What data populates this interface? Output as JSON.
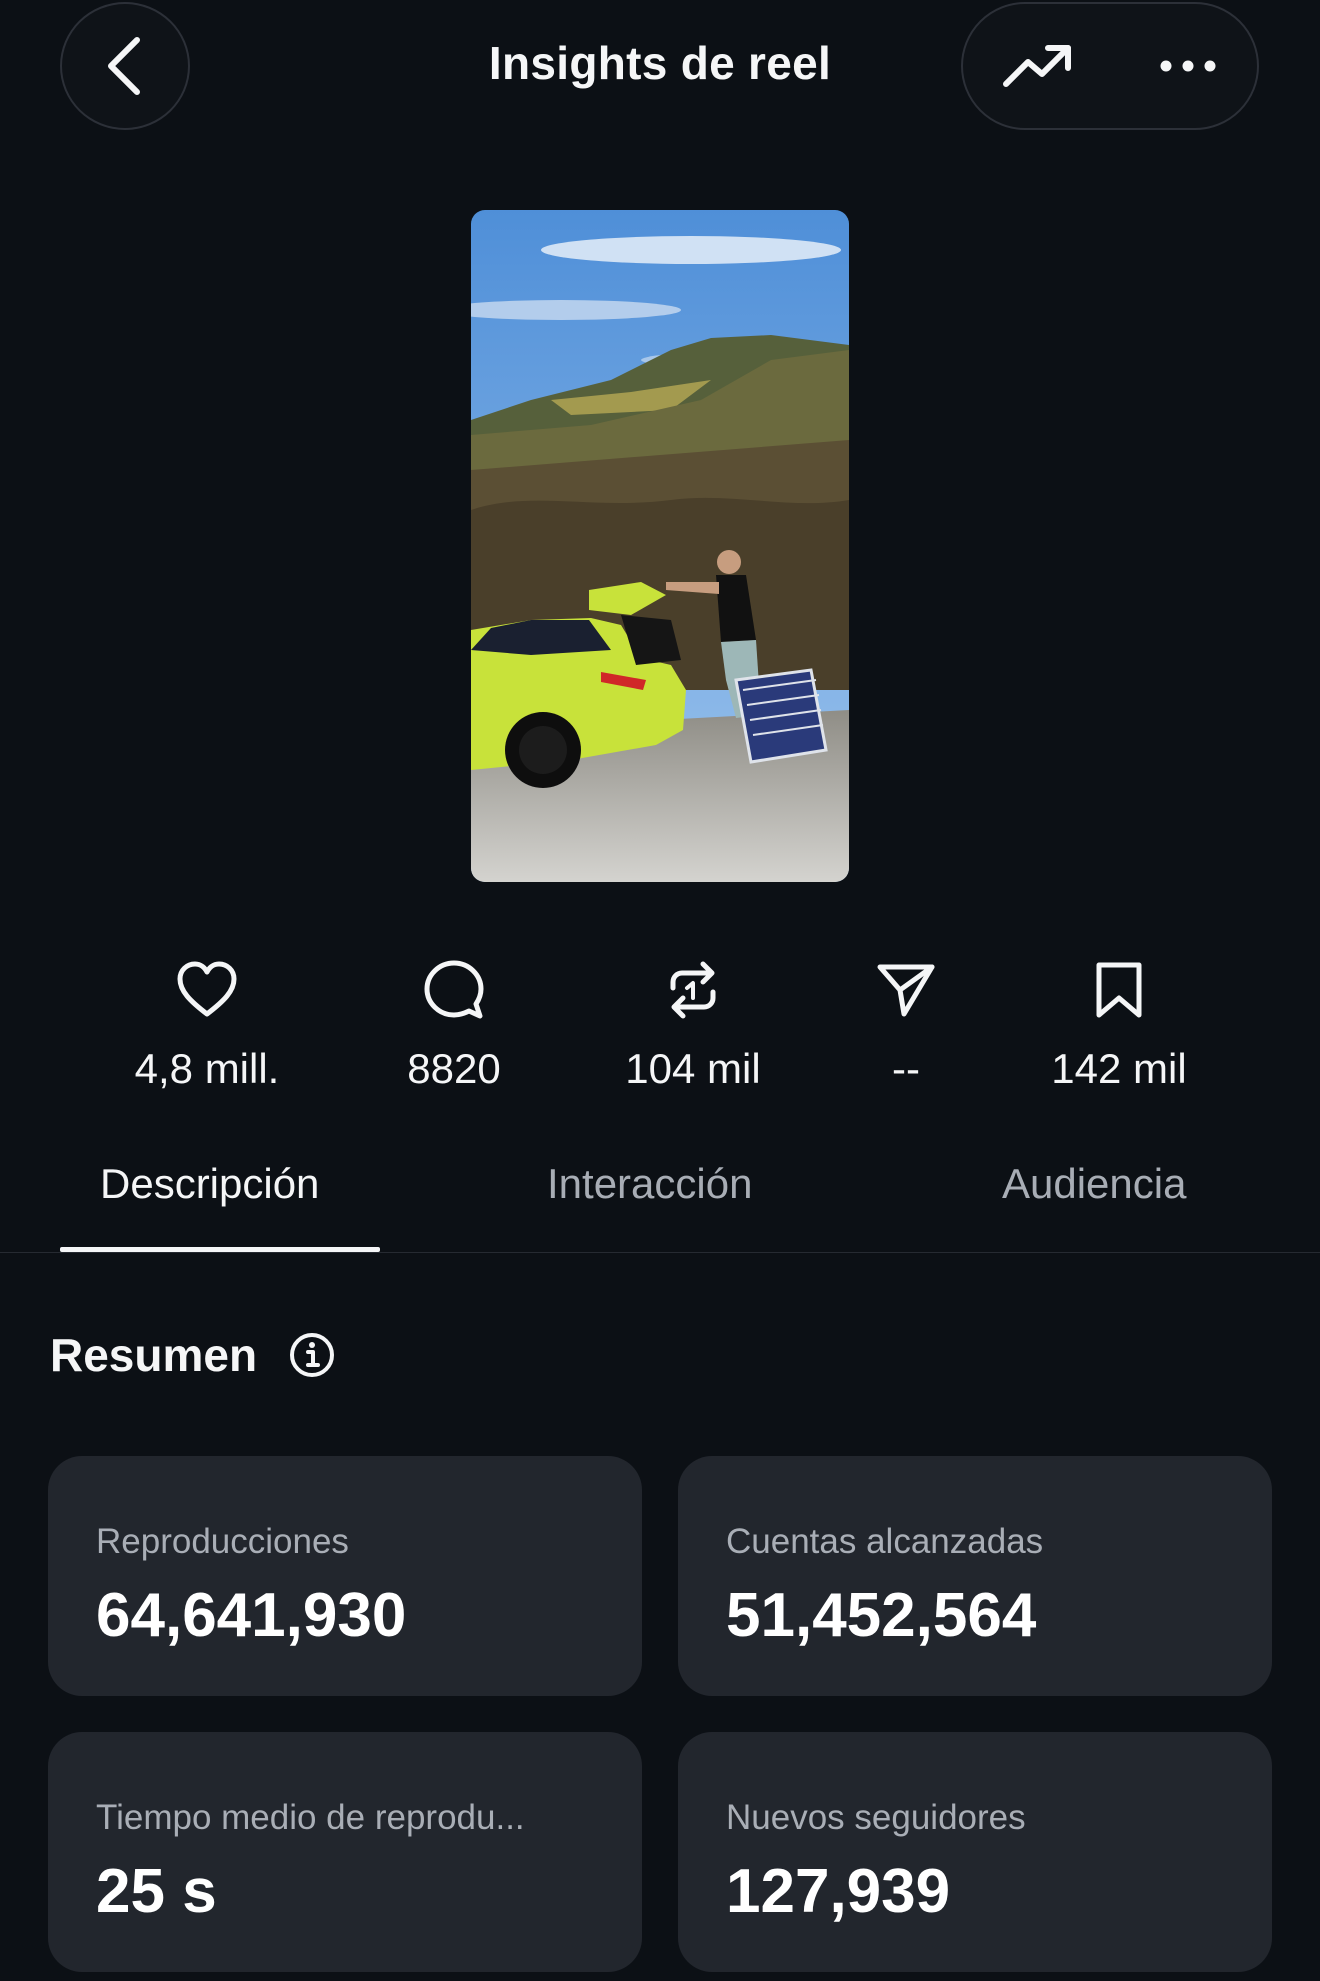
{
  "header": {
    "title": "Insights de reel"
  },
  "icons": {
    "back": "chevron-left-icon",
    "trend": "trend-up-icon",
    "more": "more-horizontal-icon"
  },
  "stats": [
    {
      "icon": "heart-icon",
      "value": "4,8 mill."
    },
    {
      "icon": "comment-icon",
      "value": "8820"
    },
    {
      "icon": "repost-icon",
      "value": "104 mil"
    },
    {
      "icon": "share-icon",
      "value": "--"
    },
    {
      "icon": "bookmark-icon",
      "value": "142 mil"
    }
  ],
  "tabs": [
    {
      "label": "Descripción",
      "active": true
    },
    {
      "label": "Interacción",
      "active": false
    },
    {
      "label": "Audiencia",
      "active": false
    }
  ],
  "summary": {
    "title": "Resumen",
    "cards": [
      {
        "label": "Reproducciones",
        "value": "64,641,930"
      },
      {
        "label": "Cuentas alcanzadas",
        "value": "51,452,564"
      },
      {
        "label": "Tiempo medio de reprodu...",
        "value": "25 s"
      },
      {
        "label": "Nuevos seguidores",
        "value": "127,939"
      }
    ]
  },
  "colors": {
    "background": "#0c1015",
    "card": "#22262d",
    "text_primary": "#f5f6f7",
    "text_secondary": "#a9aeb6"
  }
}
